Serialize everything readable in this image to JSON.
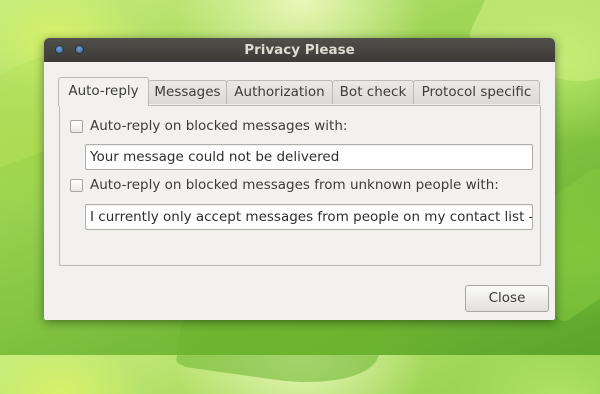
{
  "window": {
    "title": "Privacy Please"
  },
  "tabs": [
    {
      "label": "Auto-reply"
    },
    {
      "label": "Messages"
    },
    {
      "label": "Authorization"
    },
    {
      "label": "Bot check"
    },
    {
      "label": "Protocol specific"
    }
  ],
  "autoreply": {
    "blocked": {
      "label": "Auto-reply on blocked messages with:",
      "checked": false,
      "value": "Your message could not be delivered"
    },
    "unknown": {
      "label": "Auto-reply on blocked messages from unknown people with:",
      "checked": false,
      "value": "I currently only accept messages from people on my contact list - p"
    }
  },
  "buttons": {
    "close": "Close"
  },
  "colors": {
    "titlebar": "#3c3b37",
    "window_bg": "#f2f1f0",
    "title_text": "#dfdbd2"
  }
}
